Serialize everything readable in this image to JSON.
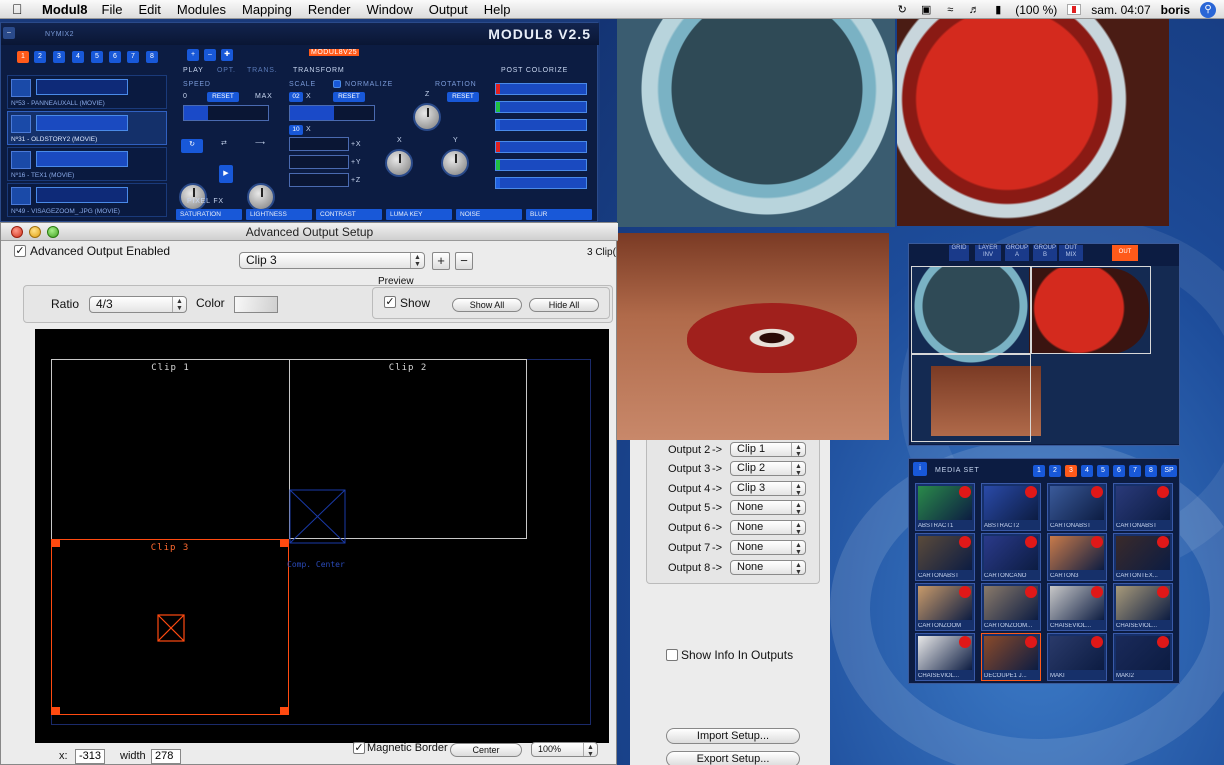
{
  "menubar": {
    "app_name": "Modul8",
    "menus": [
      "File",
      "Edit",
      "Modules",
      "Mapping",
      "Render",
      "Window",
      "Output",
      "Help"
    ],
    "battery": "(100 %)",
    "clock": "sam. 04:07",
    "user": "boris"
  },
  "modul8": {
    "title": "NYMIX2",
    "logo": "MODUL8 V2.5",
    "layer_tabs": [
      "1",
      "2",
      "3",
      "4",
      "5",
      "6",
      "7",
      "8"
    ],
    "active_layer_tab": "1",
    "layer_name_tag": "MODUL8V25",
    "layers": [
      {
        "name": "Nº53 - PANNEAUXALL (MOVIE)"
      },
      {
        "name": "Nº31 - OLDSTORY2 (MOVIE)"
      },
      {
        "name": "Nº16 - TEX1 (MOVIE)"
      },
      {
        "name": "Nº49 - VISAGEZOOM_.JPG (MOVIE)"
      }
    ],
    "tabs": [
      "PLAY",
      "OPT.",
      "TRANS."
    ],
    "sections": {
      "transform": "TRANSFORM",
      "post_colorize": "POST COLORIZE",
      "speed": "SPEED",
      "speed_min": "0",
      "speed_max": "MAX",
      "scale": "SCALE",
      "normalize": "NORMALIZE",
      "rotation": "ROTATION",
      "reset": "RESET",
      "scale_x_val": "02",
      "scale_x": "X",
      "scale_y_val": "10",
      "scale_y": "X",
      "axis_x": "+X",
      "axis_y": "+Y",
      "axis_z": "+Z",
      "knob_z": "Z",
      "knob_x": "X",
      "knob_y": "Y",
      "pixel_fx": "PIXEL FX"
    },
    "pixel_fx": [
      "SATURATION",
      "LIGHTNESS",
      "CONTRAST",
      "LUMA KEY",
      "NOISE",
      "BLUR"
    ]
  },
  "aos": {
    "window_title": "Advanced Output Setup",
    "enabled_label": "Advanced Output Enabled",
    "enabled": true,
    "clip_select": "Clip 3",
    "clip_count": "3 Clip(",
    "add_btn": "+",
    "remove_btn": "−",
    "ratio_label": "Ratio",
    "ratio_value": "4/3",
    "color_label": "Color",
    "preview_label": "Preview",
    "show_label": "Show",
    "show_all": "Show All",
    "hide_all": "Hide All",
    "clips": [
      {
        "label": "Clip 1"
      },
      {
        "label": "Clip 2"
      },
      {
        "label": "Clip 3"
      }
    ],
    "comp_center": "Comp. Center",
    "x_label": "x:",
    "x_value": "-313",
    "width_label": "width",
    "width_value": "278",
    "magnetic_label": "Magnetic Border",
    "center_btn": "Center",
    "zoom_value": "100%"
  },
  "outputs": [
    {
      "label": "Output 2",
      "arrow": "->",
      "value": "Clip 1"
    },
    {
      "label": "Output 3",
      "arrow": "->",
      "value": "Clip 2"
    },
    {
      "label": "Output 4",
      "arrow": "->",
      "value": "Clip 3"
    },
    {
      "label": "Output 5",
      "arrow": "->",
      "value": "None"
    },
    {
      "label": "Output 6",
      "arrow": "->",
      "value": "None"
    },
    {
      "label": "Output 7",
      "arrow": "->",
      "value": "None"
    },
    {
      "label": "Output 8",
      "arrow": "->",
      "value": "None"
    }
  ],
  "output_panel": {
    "show_info": "Show Info In Outputs",
    "import": "Import Setup...",
    "export": "Export Setup..."
  },
  "mapping": {
    "tabs": [
      "GRID",
      "LAYER INV",
      "GROUP A",
      "GROUP B",
      "OUT MIX",
      "OUT"
    ],
    "active": "OUT"
  },
  "media": {
    "title": "MEDIA SET",
    "info": "i",
    "tabs": [
      "1",
      "2",
      "3",
      "4",
      "5",
      "6",
      "7",
      "8",
      "SP"
    ],
    "active_tab": "3",
    "items": [
      {
        "label": "ABSTRACT1",
        "color": "#2a8a4a"
      },
      {
        "label": "ABSTRACT2",
        "color": "#2a4aa8"
      },
      {
        "label": "CARTONABST",
        "color": "#3a5a9a"
      },
      {
        "label": "CARTONABST",
        "color": "#2a3a7a"
      },
      {
        "label": "CARTONABST",
        "color": "#5a4a3a"
      },
      {
        "label": "CARTONCANO",
        "color": "#2a3a8a"
      },
      {
        "label": "CARTON3",
        "color": "#c87a4a"
      },
      {
        "label": "CARTONTEX...",
        "color": "#3a2a2a"
      },
      {
        "label": "CARTONZOOM",
        "color": "#c89a6a"
      },
      {
        "label": "CARTONZOOM...",
        "color": "#8a7a6a"
      },
      {
        "label": "CHAISEVIOL...",
        "color": "#c8c8c8"
      },
      {
        "label": "CHAISEVIOL...",
        "color": "#a89a7a"
      },
      {
        "label": "CHAISEVIOL...",
        "color": "#e8e8e8"
      },
      {
        "label": "DECOUPE1 J...",
        "color": "#8a4a2a"
      },
      {
        "label": "MAKI",
        "color": "#2a3a6a"
      },
      {
        "label": "MAKI2",
        "color": "#1a2a5a"
      }
    ]
  }
}
